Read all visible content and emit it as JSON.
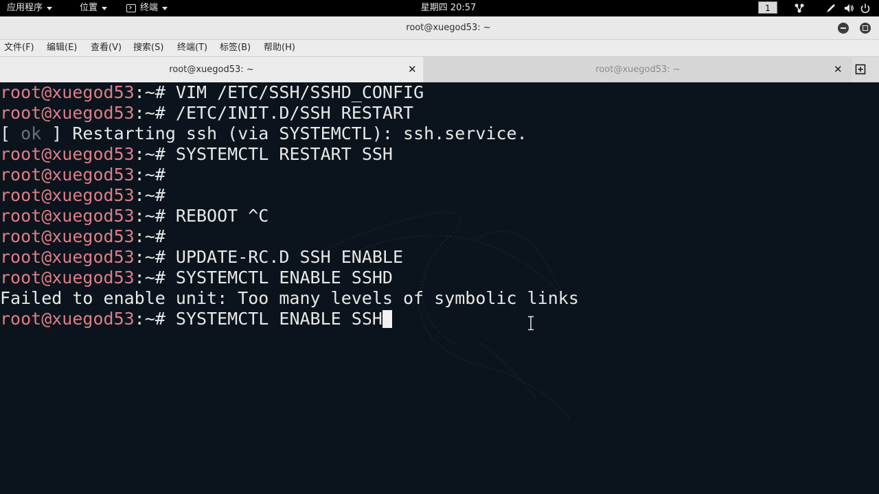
{
  "topbar": {
    "apps_menu": "应用程序",
    "places_menu": "位置",
    "terminal_menu": "终端",
    "clock": "星期四 20:57",
    "workspace": "1"
  },
  "window": {
    "title": "root@xuegod53: ~"
  },
  "menubar": {
    "file": "文件(F)",
    "edit": "编辑(E)",
    "view": "查看(V)",
    "search": "搜索(S)",
    "terminal": "终端(T)",
    "tags": "标签(B)",
    "help": "帮助(H)"
  },
  "tabs": [
    {
      "label": "root@xuegod53: ~",
      "active": true
    },
    {
      "label": "root@xuegod53: ~",
      "active": false
    }
  ],
  "terminal": {
    "prompt_user": "root@xuegod53",
    "prompt_suffix": ":~# ",
    "lines": [
      {
        "type": "cmd",
        "text": "VIM /ETC/SSH/SSHD_CONFIG"
      },
      {
        "type": "cmd",
        "text": "/ETC/INIT.D/SSH RESTART"
      },
      {
        "type": "ok",
        "open": "[ ",
        "ok": "ok",
        "rest": " ] Restarting ssh (via SYSTEMCTL): ssh.service."
      },
      {
        "type": "cmd",
        "text": "SYSTEMCTL RESTART SSH"
      },
      {
        "type": "cmd",
        "text": ""
      },
      {
        "type": "cmd",
        "text": ""
      },
      {
        "type": "cmd",
        "text": "REBOOT ^C"
      },
      {
        "type": "cmd",
        "text": ""
      },
      {
        "type": "cmd",
        "text": "UPDATE-RC.D SSH ENABLE"
      },
      {
        "type": "cmd",
        "text": "SYSTEMCTL ENABLE SSHD"
      },
      {
        "type": "out",
        "text": "Failed to enable unit: Too many levels of symbolic links"
      },
      {
        "type": "cmd",
        "text": "SYSTEMCTL ENABLE SSH"
      }
    ]
  },
  "colors": {
    "prompt_user": "#e07d88",
    "terminal_bg": "#0b141c",
    "terminal_fg": "#e8e8e8"
  }
}
